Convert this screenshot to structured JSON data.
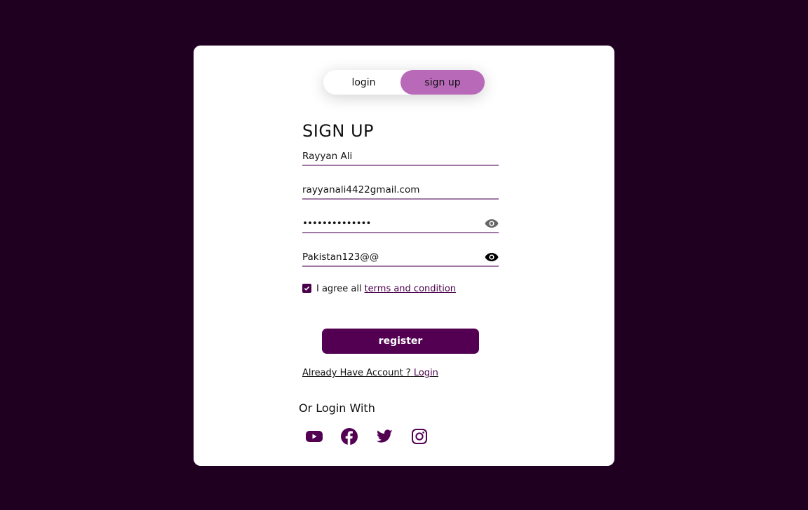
{
  "toggle": {
    "login_label": "login",
    "signup_label": "sign up",
    "active": "signup"
  },
  "form": {
    "title": "SIGN UP",
    "name_value": "Rayyan Ali",
    "email_value": "rayyanali4422gmail.com",
    "password_value": "••••••••••••••",
    "confirm_password_value": "Pakistan123@@",
    "agree_text": "I agree all",
    "terms_link": "terms and condition",
    "terms_checked": true,
    "register_label": "register",
    "already_text": "Already Have Account ?",
    "login_link": "Login"
  },
  "social": {
    "heading": "Or Login With",
    "icons": [
      "youtube-icon",
      "facebook-icon",
      "twitter-icon",
      "instagram-icon"
    ]
  },
  "colors": {
    "background": "#1f0020",
    "accent": "#530053",
    "toggle_active": "#b86ab8",
    "underline": "#a07aa4"
  }
}
